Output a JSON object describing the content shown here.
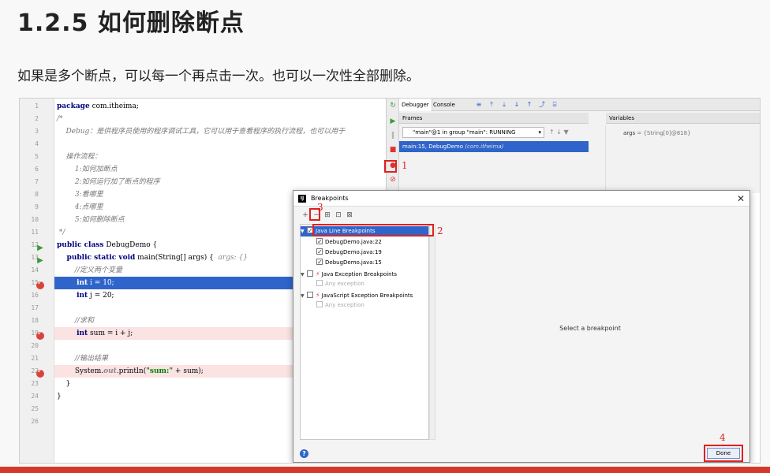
{
  "slide": {
    "title": "1.2.5 如何删除断点",
    "description": "如果是多个断点，可以每一个再点击一次。也可以一次性全部删除。"
  },
  "editor": {
    "line_numbers": [
      "1",
      "2",
      "3",
      "4",
      "5",
      "6",
      "7",
      "8",
      "9",
      "10",
      "11",
      "12",
      "13",
      "14",
      "15",
      "16",
      "17",
      "18",
      "19",
      "20",
      "21",
      "22",
      "23",
      "24",
      "25",
      "26"
    ],
    "lines": {
      "l1a": "package",
      "l1b": " com.itheima;",
      "l2": "/*",
      "l3": "    Debug：是供程序员使用的程序调试工具，它可以用于查看程序的执行流程，也可以用于",
      "l5": "    操作流程：",
      "l6": "        1:如何加断点",
      "l7": "        2:如何运行加了断点的程序",
      "l8": "        3:看哪里",
      "l9": "        4:点哪里",
      "l10": "        5:如何删除断点",
      "l11": " */",
      "l12a": "public class",
      "l12b": " DebugDemo {",
      "l13a": "    public static void",
      "l13b": " main(String[] args) {  ",
      "l13c": "args: {}",
      "l14": "        //定义两个变量",
      "l15a": "        int",
      "l15b": " i = 10;",
      "l16a": "        int",
      "l16b": " j = 20;",
      "l18": "        //求和",
      "l19a": "        int",
      "l19b": " sum = i + j;",
      "l21": "        //输出结果",
      "l22a": "        System.",
      "l22b": "out",
      "l22c": ".println(",
      "l22d": "\"sum:\"",
      "l22e": " + sum);",
      "l23": "    }",
      "l24": "}"
    }
  },
  "debugger": {
    "tab_debugger": "Debugger",
    "tab_console": "Console",
    "frames_label": "Frames",
    "variables_label": "Variables",
    "thread": "\"main\"@1 in group \"main\": RUNNING",
    "frame": "main:15, DebugDemo",
    "frame_pkg": "(com.itheima)",
    "var_name": "args",
    "var_value": " = {String[0]@818}"
  },
  "annotations": {
    "n1": "1",
    "n2": "2",
    "n3": "3",
    "n4": "4"
  },
  "dialog": {
    "title": "Breakpoints",
    "tree": {
      "java_line": "Java Line Breakpoints",
      "bp1": "DebugDemo.java:22",
      "bp2": "DebugDemo.java:19",
      "bp3": "DebugDemo.java:15",
      "java_exception": "Java Exception Breakpoints",
      "any1": "Any exception",
      "js_exception": "JavaScript Exception Breakpoints",
      "any2": "Any exception"
    },
    "placeholder": "Select a breakpoint",
    "help": "?",
    "done": "Done"
  },
  "colors": {
    "accent": "#2f65ca",
    "breakpoint": "#d8443c",
    "annotation": "#e02020"
  }
}
